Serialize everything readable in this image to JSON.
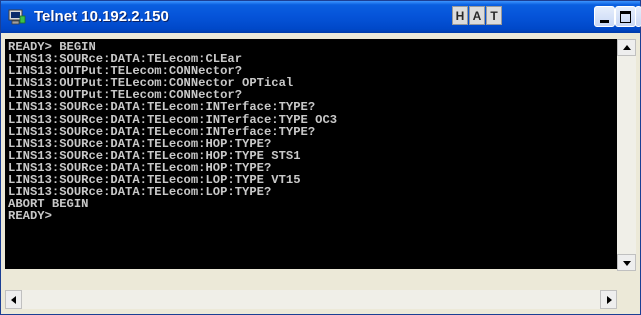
{
  "window": {
    "title": "Telnet 10.192.2.150",
    "hat_buttons": [
      "H",
      "A",
      "T"
    ]
  },
  "colors": {
    "titlebar": "#0553d8",
    "terminal_bg": "#000000",
    "terminal_text": "#c8c8c8"
  },
  "icons": {
    "app": "telnet-icon",
    "minimize": "minimize-icon",
    "maximize": "maximize-icon",
    "close": "close-icon",
    "up": "arrow-up-icon",
    "down": "arrow-down-icon",
    "left": "arrow-left-icon",
    "right": "arrow-right-icon"
  },
  "terminal": {
    "lines": [
      "READY> BEGIN",
      "LINS13:SOURce:DATA:TELecom:CLEar",
      "LINS13:OUTPut:TELecom:CONNector?",
      "LINS13:OUTPut:TELecom:CONNector OPTical",
      "LINS13:OUTPut:TELecom:CONNector?",
      "LINS13:SOURce:DATA:TELecom:INTerface:TYPE?",
      "LINS13:SOURce:DATA:TELecom:INTerface:TYPE OC3",
      "LINS13:SOURce:DATA:TELecom:INTerface:TYPE?",
      "LINS13:SOURce:DATA:TELecom:HOP:TYPE?",
      "LINS13:SOURce:DATA:TELecom:HOP:TYPE STS1",
      "LINS13:SOURce:DATA:TELecom:HOP:TYPE?",
      "LINS13:SOURce:DATA:TELecom:LOP:TYPE VT15",
      "LINS13:SOURce:DATA:TELecom:LOP:TYPE?",
      "ABORT BEGIN",
      "READY>"
    ]
  }
}
